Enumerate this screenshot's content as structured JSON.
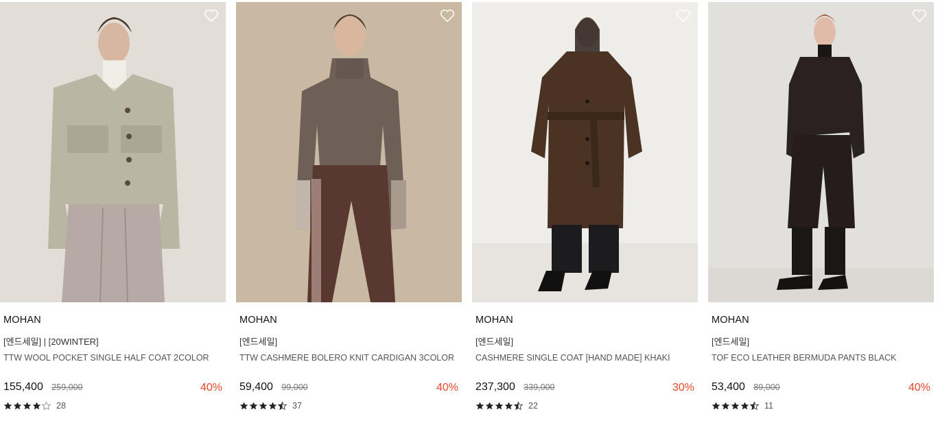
{
  "products": [
    {
      "brand": "MOHAN",
      "tag": "[엔드세일] | [20WINTER]",
      "name": "TTW WOOL POCKET SINGLE HALF COAT 2COLOR",
      "price": "155,400",
      "original_price": "259,000",
      "discount": "40%",
      "rating": 4,
      "review_count": "28",
      "colors": {
        "bg": "#e6e3dc",
        "garment": "#b9b6a4",
        "bottom": "#b7a9a3"
      }
    },
    {
      "brand": "MOHAN",
      "tag": "[엔드세일]",
      "name": "TTW CASHMERE BOLERO KNIT CARDIGAN 3COLOR",
      "price": "59,400",
      "original_price": "99,000",
      "discount": "40%",
      "rating": 4.5,
      "review_count": "37",
      "colors": {
        "bg": "#cdbda7",
        "garment": "#6f6057",
        "bottom": "#5a3832"
      }
    },
    {
      "brand": "MOHAN",
      "tag": "[엔드세일]",
      "name": "CASHMERE SINGLE COAT [HAND MADE] KHAKI",
      "price": "237,300",
      "original_price": "339,000",
      "discount": "30%",
      "rating": 4.5,
      "review_count": "22",
      "colors": {
        "bg": "#efedea",
        "garment": "#4a3322",
        "bottom": "#1c1c1e"
      }
    },
    {
      "brand": "MOHAN",
      "tag": "[엔드세일]",
      "name": "TOF ECO LEATHER BERMUDA PANTS BLACK",
      "price": "53,400",
      "original_price": "89,000",
      "discount": "40%",
      "rating": 4.5,
      "review_count": "11",
      "colors": {
        "bg": "#e2e0dc",
        "garment": "#2a2222",
        "bottom": "#241d1c"
      }
    }
  ],
  "icons": {
    "wishlist": "heart-outline-icon",
    "star": "star-icon"
  },
  "accent": {
    "discount": "#e8462a"
  }
}
